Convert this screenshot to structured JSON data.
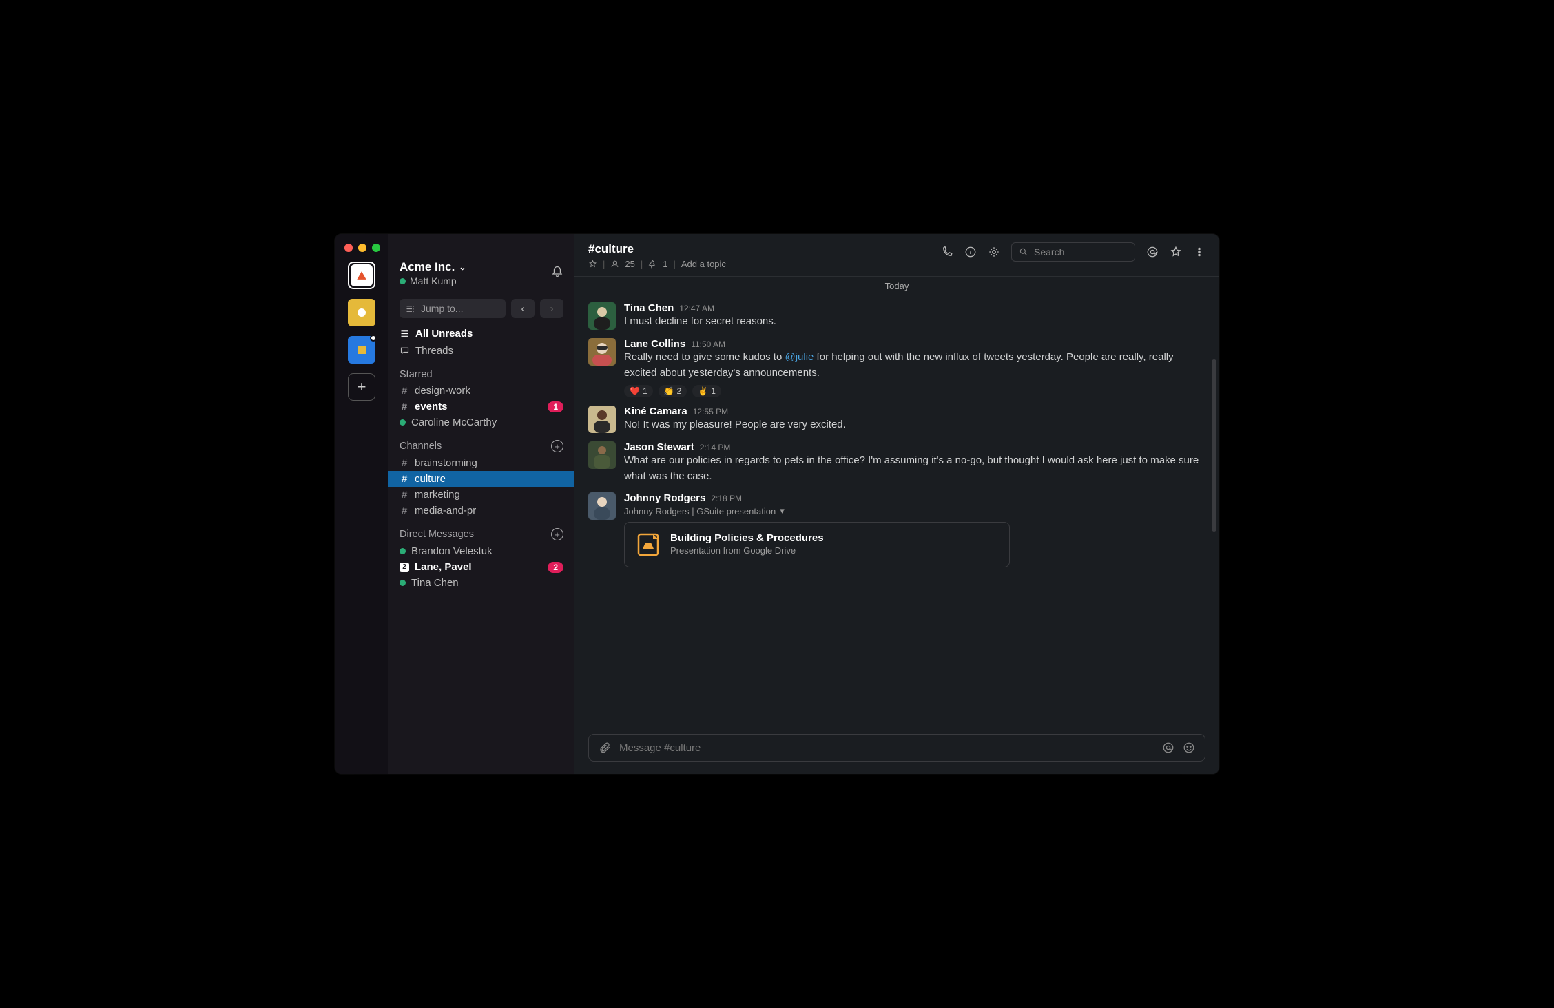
{
  "workspace": {
    "name": "Acme Inc.",
    "user": "Matt Kump"
  },
  "jump_placeholder": "Jump to...",
  "nav": {
    "all_unreads": "All Unreads",
    "threads": "Threads"
  },
  "sections": {
    "starred": "Starred",
    "channels": "Channels",
    "dms": "Direct Messages"
  },
  "starred": [
    {
      "type": "channel",
      "name": "design-work",
      "unread": false
    },
    {
      "type": "channel",
      "name": "events",
      "unread": true,
      "badge": "1"
    },
    {
      "type": "dm",
      "name": "Caroline McCarthy",
      "presence": true
    }
  ],
  "channels": [
    {
      "name": "brainstorming"
    },
    {
      "name": "culture",
      "selected": true
    },
    {
      "name": "marketing"
    },
    {
      "name": "media-and-pr"
    }
  ],
  "dms": [
    {
      "name": "Brandon Velestuk",
      "presence": true
    },
    {
      "name": "Lane, Pavel",
      "group": "2",
      "unread": true,
      "badge": "2"
    },
    {
      "name": "Tina Chen",
      "presence": true
    }
  ],
  "channel_header": {
    "title": "#culture",
    "members": "25",
    "pins": "1",
    "add_topic": "Add a topic"
  },
  "search_placeholder": "Search",
  "divider": "Today",
  "messages": [
    {
      "author": "Tina Chen",
      "time": "12:47 AM",
      "text": "I must decline for secret reasons.",
      "avatar_bg": "#2c5f3f"
    },
    {
      "author": "Lane Collins",
      "time": "11:50 AM",
      "text_pre": "Really need to give some kudos to ",
      "mention": "@julie",
      "text_post": " for helping out with the new influx of tweets yesterday. People are really, really excited about yesterday's announcements.",
      "avatar_bg": "#8a6d3b",
      "reactions": [
        {
          "emoji": "❤️",
          "count": "1"
        },
        {
          "emoji": "👏",
          "count": "2"
        },
        {
          "emoji": "✌️",
          "count": "1"
        }
      ]
    },
    {
      "author": "Kiné Camara",
      "time": "12:55 PM",
      "text": "No! It was my pleasure! People are very excited.",
      "avatar_bg": "#c9b98e"
    },
    {
      "author": "Jason Stewart",
      "time": "2:14 PM",
      "text": "What are our policies in regards to pets in the office? I'm assuming it's a no-go, but thought I would ask here just to make sure what was the case.",
      "avatar_bg": "#3a4a34"
    },
    {
      "author": "Johnny Rodgers",
      "time": "2:18 PM",
      "avatar_bg": "#4a5a6a",
      "attach_meta": "Johnny Rodgers | GSuite presentation",
      "attach_title": "Building Policies & Procedures",
      "attach_sub": "Presentation from Google Drive"
    }
  ],
  "composer_placeholder": "Message #culture"
}
